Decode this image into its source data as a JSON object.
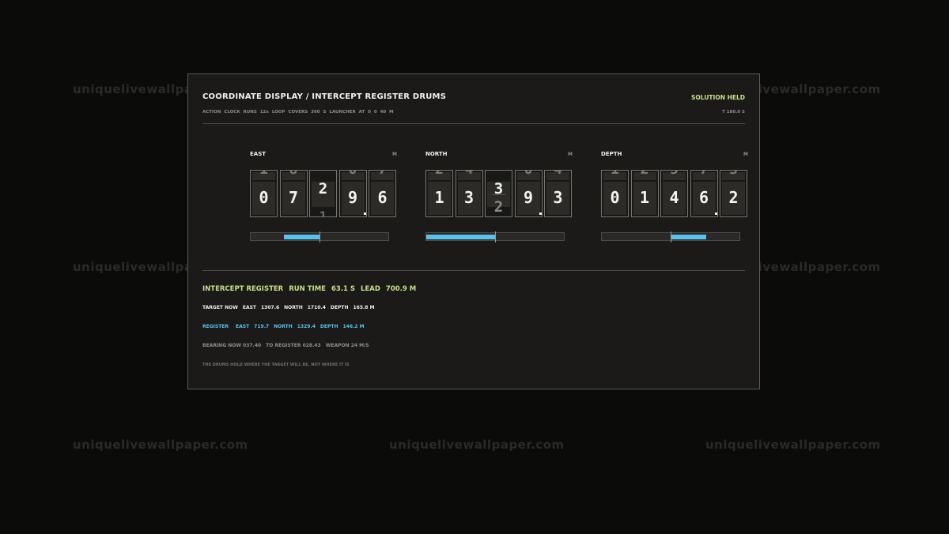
{
  "watermark": "uniquelivewallpaper.com",
  "title": "COORDINATE DISPLAY / INTERCEPT REGISTER DRUMS",
  "status": "SOLUTION HELD",
  "subtitle": {
    "clock_rate": "ACTION CLOCK RUNS 12x",
    "loop": "LOOP COVERS 360 S",
    "launcher": "LAUNCHER AT 0 0 40 M"
  },
  "clock": "T 180.0 S",
  "drums": [
    {
      "label": "EAST",
      "unit": "M",
      "digits": [
        "0",
        "7",
        "2",
        "9",
        "6"
      ],
      "above": [
        "1",
        "8",
        "",
        "0",
        "7"
      ],
      "rolling_index": 2,
      "rolling_below": "1",
      "bar": {
        "fill_start": 0.24,
        "fill_end": 0.5
      }
    },
    {
      "label": "NORTH",
      "unit": "M",
      "digits": [
        "1",
        "3",
        "3",
        "9",
        "3"
      ],
      "above": [
        "2",
        "4",
        "",
        "0",
        "4"
      ],
      "rolling_index": 2,
      "rolling_next": "2",
      "bar": {
        "fill_start": 0.0,
        "fill_end": 0.5
      }
    },
    {
      "label": "DEPTH",
      "unit": "M",
      "digits": [
        "0",
        "1",
        "4",
        "6",
        "2"
      ],
      "above": [
        "1",
        "2",
        "5",
        "7",
        "3"
      ],
      "bar": {
        "fill_start": 0.5,
        "fill_end": 0.76
      }
    }
  ],
  "register": {
    "header": {
      "label": "INTERCEPT REGISTER",
      "run_time": "RUN TIME",
      "run_time_value": "63.1 S",
      "lead": "LEAD",
      "lead_value": "700.9 M"
    },
    "target": {
      "label": "TARGET NOW",
      "east": "EAST",
      "east_value": "1307.6",
      "north": "NORTH",
      "north_value": "1710.4",
      "depth": "DEPTH",
      "depth_value": "165.8 M"
    },
    "reg": {
      "label": "REGISTER",
      "east": "EAST",
      "east_value": "719.7",
      "north": "NORTH",
      "north_value": "1329.4",
      "depth": "DEPTH",
      "depth_value": "146.2 M"
    },
    "bearing": {
      "bearing": "BEARING NOW 037.40",
      "to_register": "TO REGISTER 028.43",
      "weapon": "WEAPON 24 M/S"
    },
    "note": "THE DRUMS HOLD WHERE THE TARGET WILL BE, NOT WHERE IT IS"
  },
  "colors": {
    "accent_green": "#c5e08a",
    "accent_blue": "#56c2f0",
    "panel": "#1b1a18"
  }
}
